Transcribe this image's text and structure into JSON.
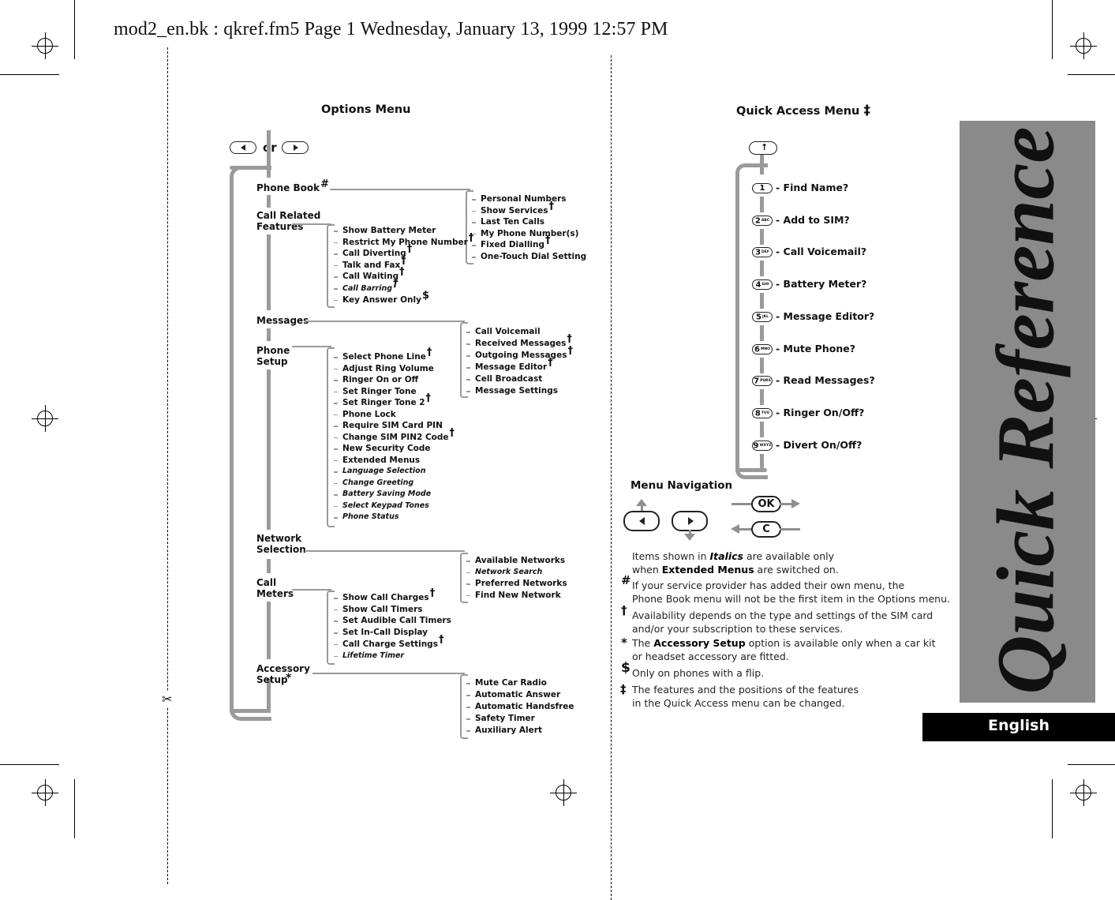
{
  "header": {
    "text": "mod2_en.bk : qkref.fm5  Page 1  Wednesday, January 13, 1999  12:57 PM"
  },
  "options_menu": {
    "title": "Options Menu",
    "nav_or": "or",
    "top_items": [
      {
        "label": "Phone Book",
        "mark": "#"
      },
      {
        "label": "Call Related\nFeatures",
        "mark": ""
      },
      {
        "label": "Messages",
        "mark": ""
      },
      {
        "label": "Phone\nSetup",
        "mark": ""
      },
      {
        "label": "Network\nSelection",
        "mark": ""
      },
      {
        "label": "Call\nMeters",
        "mark": ""
      },
      {
        "label": "Accessory\nSetup",
        "mark": "*"
      }
    ],
    "phone_book": [
      {
        "label": "Personal Numbers",
        "mark": "",
        "italic": false
      },
      {
        "label": "Show Services",
        "mark": "†",
        "italic": false
      },
      {
        "label": "Last Ten Calls",
        "mark": "",
        "italic": false
      },
      {
        "label": "My Phone Number(s)",
        "mark": "",
        "italic": false
      },
      {
        "label": "Fixed Dialling",
        "mark": "†",
        "italic": false
      },
      {
        "label": "One-Touch Dial Setting",
        "mark": "",
        "italic": false
      }
    ],
    "call_related_features": [
      {
        "label": "Show Battery Meter",
        "mark": "",
        "italic": false
      },
      {
        "label": "Restrict My Phone Number",
        "mark": "†",
        "italic": false
      },
      {
        "label": "Call Diverting",
        "mark": "†",
        "italic": false
      },
      {
        "label": "Talk and Fax",
        "mark": "†",
        "italic": false
      },
      {
        "label": "Call Waiting",
        "mark": "†",
        "italic": false
      },
      {
        "label": "Call Barring",
        "mark": "†",
        "italic": true
      },
      {
        "label": "Key Answer Only",
        "mark": "$",
        "italic": false
      }
    ],
    "messages": [
      {
        "label": "Call Voicemail",
        "mark": "",
        "italic": false
      },
      {
        "label": "Received Messages",
        "mark": "†",
        "italic": false
      },
      {
        "label": "Outgoing Messages",
        "mark": "†",
        "italic": false
      },
      {
        "label": "Message Editor",
        "mark": "†",
        "italic": false
      },
      {
        "label": "Cell Broadcast",
        "mark": "",
        "italic": false
      },
      {
        "label": "Message Settings",
        "mark": "",
        "italic": false
      }
    ],
    "phone_setup": [
      {
        "label": "Select Phone Line",
        "mark": "†",
        "italic": false
      },
      {
        "label": "Adjust Ring Volume",
        "mark": "",
        "italic": false
      },
      {
        "label": "Ringer On or Off",
        "mark": "",
        "italic": false
      },
      {
        "label": "Set Ringer Tone",
        "mark": "",
        "italic": false
      },
      {
        "label": "Set Ringer Tone 2",
        "mark": "†",
        "italic": false
      },
      {
        "label": "Phone Lock",
        "mark": "",
        "italic": false
      },
      {
        "label": "Require SIM Card PIN",
        "mark": "",
        "italic": false
      },
      {
        "label": "Change SIM PIN2 Code",
        "mark": "†",
        "italic": false
      },
      {
        "label": "New Security Code",
        "mark": "",
        "italic": false
      },
      {
        "label": "Extended Menus",
        "mark": "",
        "italic": false
      },
      {
        "label": "Language Selection",
        "mark": "",
        "italic": true
      },
      {
        "label": "Change Greeting",
        "mark": "",
        "italic": true
      },
      {
        "label": "Battery Saving Mode",
        "mark": "",
        "italic": true
      },
      {
        "label": "Select Keypad Tones",
        "mark": "",
        "italic": true
      },
      {
        "label": "Phone Status",
        "mark": "",
        "italic": true
      }
    ],
    "network_selection": [
      {
        "label": "Available Networks",
        "mark": "",
        "italic": false
      },
      {
        "label": "Network Search",
        "mark": "",
        "italic": true
      },
      {
        "label": "Preferred Networks",
        "mark": "",
        "italic": false
      },
      {
        "label": "Find New Network",
        "mark": "",
        "italic": false
      }
    ],
    "call_meters": [
      {
        "label": "Show Call Charges",
        "mark": "†",
        "italic": false
      },
      {
        "label": "Show Call Timers",
        "mark": "",
        "italic": false
      },
      {
        "label": "Set Audible Call Timers",
        "mark": "",
        "italic": false
      },
      {
        "label": "Set In-Call Display",
        "mark": "",
        "italic": false
      },
      {
        "label": "Call Charge Settings",
        "mark": "†",
        "italic": false
      },
      {
        "label": "Lifetime Timer",
        "mark": "",
        "italic": true
      }
    ],
    "accessory_setup": [
      {
        "label": "Mute Car Radio",
        "mark": "",
        "italic": false
      },
      {
        "label": "Automatic Answer",
        "mark": "",
        "italic": false
      },
      {
        "label": "Automatic Handsfree",
        "mark": "",
        "italic": false
      },
      {
        "label": "Safety Timer",
        "mark": "",
        "italic": false
      },
      {
        "label": "Auxiliary Alert",
        "mark": "",
        "italic": false
      }
    ]
  },
  "quick_access": {
    "title": "Quick Access Menu",
    "title_mark": "‡",
    "items": [
      {
        "key": "1",
        "sub": "",
        "label": "- Find Name?"
      },
      {
        "key": "2",
        "sub": "ABC",
        "label": "- Add to SIM?"
      },
      {
        "key": "3",
        "sub": "DEF",
        "label": "- Call Voicemail?"
      },
      {
        "key": "4",
        "sub": "GHI",
        "label": "- Battery Meter?"
      },
      {
        "key": "5",
        "sub": "JKL",
        "label": "- Message Editor?"
      },
      {
        "key": "6",
        "sub": "MNO",
        "label": "- Mute Phone?"
      },
      {
        "key": "7",
        "sub": "PQRS",
        "label": "- Read Messages?"
      },
      {
        "key": "8",
        "sub": "TUV",
        "label": "- Ringer On/Off?"
      },
      {
        "key": "9",
        "sub": "WXYZ",
        "label": "- Divert On/Off?"
      }
    ]
  },
  "menu_navigation": {
    "title": "Menu Navigation",
    "ok_label": "OK",
    "c_label": "C"
  },
  "notes": {
    "italics_line1_pre": "Items shown in ",
    "italics_word": "Italics",
    "italics_line1_post": " are available only",
    "italics_line2_pre": "when ",
    "italics_line2_bold": "Extended Menus",
    "italics_line2_post": " are switched on.",
    "footnotes": [
      {
        "symbol": "#",
        "lines": [
          "If your service provider has added their own menu, the",
          "Phone Book menu will not be the first item in the Options menu."
        ]
      },
      {
        "symbol": "†",
        "lines": [
          "Availability depends on the type and settings of the SIM card",
          "and/or your subscription to these services."
        ]
      },
      {
        "symbol": "*",
        "pre": "The ",
        "bold": "Accessory Setup",
        "post": " option is available only when a car kit",
        "line2": "or headset accessory are fitted."
      },
      {
        "symbol": "$",
        "lines": [
          "Only on phones with a flip."
        ]
      },
      {
        "symbol": "‡",
        "lines": [
          "The features and the positions of the features",
          "in the Quick Access menu can be changed."
        ]
      }
    ]
  },
  "sidebar": {
    "title": "Quick Reference",
    "language_tab": "English"
  },
  "colors": {
    "side_panel": "#8a8a8a",
    "tree_lines": "#9a9a9a",
    "language_tab": "#000000"
  }
}
